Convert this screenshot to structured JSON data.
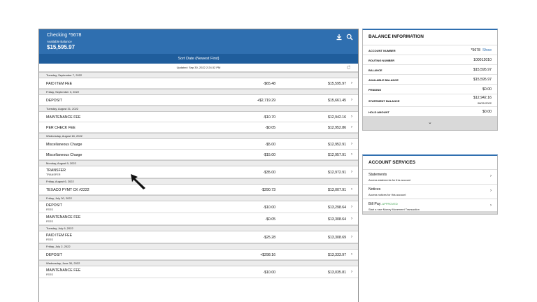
{
  "account": {
    "title": "Checking *5678",
    "available_label": "Available Balance",
    "available_value": "$15,595.97"
  },
  "sort_label": "Sort Date (Newest First)",
  "updated": "Updated: Sep 30, 2022 2:24:32 PM",
  "transactions": [
    {
      "date": "Tuesday, September 7, 2022",
      "name": "PAID ITEM FEE",
      "sub": "",
      "amount": "-$65.48",
      "balance": "$15,595.97"
    },
    {
      "date": "Friday, September 3, 2022",
      "name": "DEPOSIT",
      "sub": "",
      "amount": "+$2,719.29",
      "balance": "$15,661.45"
    },
    {
      "date": "Tuesday, August 31, 2022",
      "name": "MAINTENANCE FEE",
      "sub": "",
      "amount": "-$10.70",
      "balance": "$12,942.16"
    },
    {
      "date": "",
      "name": "PER CHECK FEE",
      "sub": "",
      "amount": "-$0.05",
      "balance": "$12,952.86"
    },
    {
      "date": "Wednesday, August 18, 2022",
      "name": "Miscellaneous Charge",
      "sub": "",
      "amount": "-$5.00",
      "balance": "$12,952.91"
    },
    {
      "date": "",
      "name": "Miscellaneous Charge",
      "sub": "",
      "amount": "-$15.00",
      "balance": "$12,957.91"
    },
    {
      "date": "Monday, August 9, 2022",
      "name": "TRANSFER",
      "sub": "TRANSFER",
      "amount": "-$35.00",
      "balance": "$12,972.91"
    },
    {
      "date": "Friday, August 6, 2022",
      "name": "TEXACO PYMT CK #2222",
      "sub": "",
      "amount": "-$290.73",
      "balance": "$13,007.91"
    },
    {
      "date": "Friday, July 30, 2022",
      "name": "DEPOSIT",
      "sub": "FEES",
      "amount": "-$10.00",
      "balance": "$13,298.64"
    },
    {
      "date": "",
      "name": "MAINTENANCE FEE",
      "sub": "FEES",
      "amount": "-$0.05",
      "balance": "$13,308.64"
    },
    {
      "date": "Tuesday, July 6, 2022",
      "name": "PAID ITEM FEE",
      "sub": "FEES",
      "amount": "-$25.28",
      "balance": "$13,308.69"
    },
    {
      "date": "Friday, July 2, 2022",
      "name": "DEPOSIT",
      "sub": "",
      "amount": "+$298.16",
      "balance": "$13,333.97"
    },
    {
      "date": "Wednesday, June 30, 2022",
      "name": "MAINTENANCE FEE",
      "sub": "FEES",
      "amount": "-$10.00",
      "balance": "$13,035.81"
    }
  ],
  "balance_info": {
    "title": "BALANCE INFORMATION",
    "rows": [
      {
        "label": "ACCOUNT NUMBER",
        "value": "*5678",
        "link": "Show"
      },
      {
        "label": "ROUTING NUMBER",
        "value": "100012010"
      },
      {
        "label": "BALANCE",
        "value": "$15,595.97"
      },
      {
        "label": "AVAILABLE BALANCE",
        "value": "$15,595.97"
      },
      {
        "label": "PENDING",
        "value": "$0.00"
      },
      {
        "label": "STATEMENT BALANCE",
        "value": "$12,942.16",
        "value2": "08/31/2022"
      },
      {
        "label": "HOLD AMOUNT",
        "value": "$0.00"
      }
    ]
  },
  "services": {
    "title": "ACCOUNT SERVICES",
    "items": [
      {
        "title": "Statements",
        "desc": "Access statements for this account"
      },
      {
        "title": "Notices",
        "desc": "Access notices for this account"
      },
      {
        "title": "Bill Pay",
        "status": "- APPROVED",
        "desc": "Start a new Money Movement Transaction"
      }
    ]
  },
  "colors": {
    "header_blue": "#2f6fb0",
    "sort_blue": "#1f5d9c",
    "approved_green": "#3fa24f"
  },
  "icons": [
    "download-icon",
    "search-icon",
    "refresh-icon",
    "chevron-right-icon",
    "chevron-down-icon",
    "mouse-pointer-icon"
  ]
}
